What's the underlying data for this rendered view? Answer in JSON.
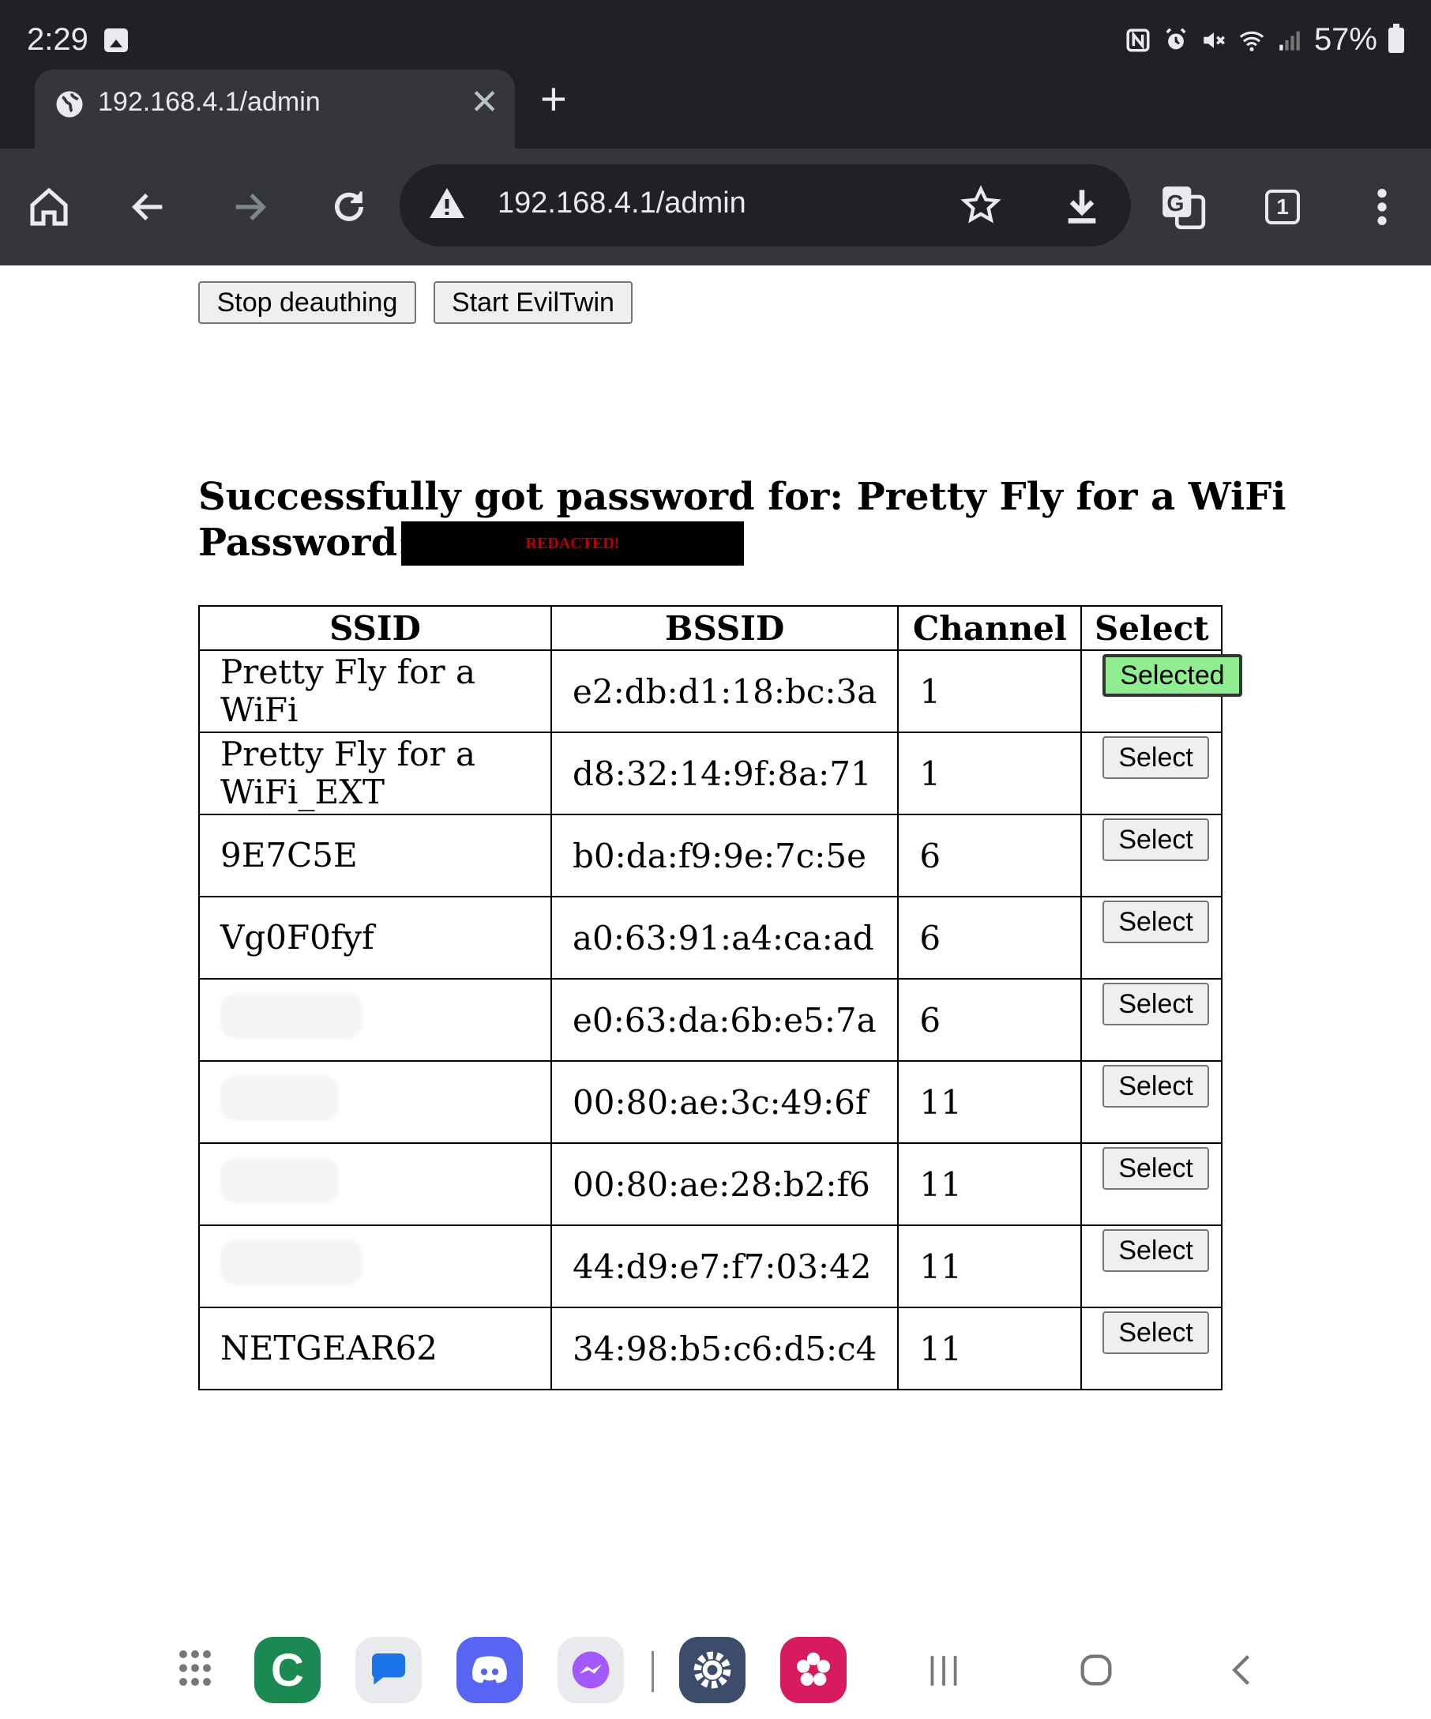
{
  "status": {
    "time": "2:29",
    "battery": "57%"
  },
  "tab": {
    "title": "192.168.4.1/admin"
  },
  "omnibox": {
    "url": "192.168.4.1/admin"
  },
  "toolbar": {
    "tab_count": "1"
  },
  "actions": {
    "stop_deauth": "Stop deauthing",
    "start_eviltwin": "Start EvilTwin"
  },
  "result": {
    "line1": "Successfully got password for: Pretty Fly for a WiFi",
    "password_label": "Password:",
    "redacted": "REDACTED!"
  },
  "table": {
    "headers": [
      "SSID",
      "BSSID",
      "Channel",
      "Select"
    ],
    "rows": [
      {
        "ssid": "Pretty Fly for a WiFi",
        "bssid": "e2:db:d1:18:bc:3a",
        "channel": "1",
        "select": "Selected"
      },
      {
        "ssid": "Pretty Fly for a WiFi_EXT",
        "bssid": "d8:32:14:9f:8a:71",
        "channel": "1",
        "select": "Select"
      },
      {
        "ssid": "9E7C5E",
        "bssid": "b0:da:f9:9e:7c:5e",
        "channel": "6",
        "select": "Select"
      },
      {
        "ssid": "Vg0F0fyf",
        "bssid": "a0:63:91:a4:ca:ad",
        "channel": "6",
        "select": "Select"
      },
      {
        "ssid": "",
        "bssid": "e0:63:da:6b:e5:7a",
        "channel": "6",
        "select": "Select"
      },
      {
        "ssid": "",
        "bssid": "00:80:ae:3c:49:6f",
        "channel": "11",
        "select": "Select"
      },
      {
        "ssid": "",
        "bssid": "00:80:ae:28:b2:f6",
        "channel": "11",
        "select": "Select"
      },
      {
        "ssid": "",
        "bssid": "44:d9:e7:f7:03:42",
        "channel": "11",
        "select": "Select"
      },
      {
        "ssid": "NETGEAR62",
        "bssid": "34:98:b5:c6:d5:c4",
        "channel": "11",
        "select": "Select"
      }
    ]
  },
  "dock": {
    "apps": [
      "app-drawer-icon",
      "c-app-icon",
      "messages-icon",
      "discord-icon",
      "messenger-icon",
      "settings-icon",
      "gallery-icon"
    ],
    "colors": {
      "green": "#1b8a52",
      "blue": "#1a73e8",
      "discord": "#5865f2",
      "settings": "#3c4c6a",
      "pink": "#d81b60"
    }
  },
  "colors": {
    "chrome_dark": "#202124",
    "toolbar": "#35363a",
    "selected_green": "#90ee90"
  }
}
